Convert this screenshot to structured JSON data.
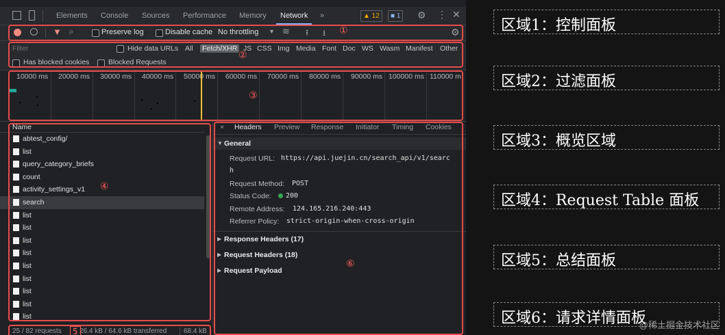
{
  "tabs": [
    "Elements",
    "Console",
    "Sources",
    "Performance",
    "Memory",
    "Network",
    "»"
  ],
  "active_tab": "Network",
  "badges": {
    "warnings": "▲ 12",
    "messages": "■ 1"
  },
  "toolbar": {
    "preserve_log": "Preserve log",
    "disable_cache": "Disable cache",
    "throttling": "No throttling"
  },
  "filter": {
    "placeholder": "Filter",
    "hide_data_urls": "Hide data URLs",
    "types": [
      "All",
      "Fetch/XHR",
      "JS",
      "CSS",
      "Img",
      "Media",
      "Font",
      "Doc",
      "WS",
      "Wasm",
      "Manifest",
      "Other"
    ],
    "selected_type": "Fetch/XHR",
    "has_blocked_cookies": "Has blocked cookies",
    "blocked_requests": "Blocked Requests"
  },
  "overview": {
    "ticks": [
      "10000 ms",
      "20000 ms",
      "30000 ms",
      "40000 ms",
      "50000 ms",
      "60000 ms",
      "70000 ms",
      "80000 ms",
      "90000 ms",
      "100000 ms",
      "110000 m"
    ]
  },
  "table": {
    "header": "Name",
    "rows": [
      "abtest_config/",
      "list",
      "query_category_briefs",
      "count",
      "activity_settings_v1",
      "search",
      "list",
      "list",
      "list",
      "list",
      "list",
      "list",
      "list",
      "list",
      "list"
    ],
    "selected_index": 5
  },
  "details": {
    "close": "×",
    "tabs": [
      "Headers",
      "Preview",
      "Response",
      "Initiator",
      "Timing",
      "Cookies"
    ],
    "active_tab": "Headers",
    "general_title": "General",
    "request_url_label": "Request URL:",
    "request_url_value": "https://api.juejin.cn/search_api/v1/searc",
    "request_url_wrap": "h",
    "method_label": "Request Method:",
    "method_value": "POST",
    "status_label": "Status Code:",
    "status_value": "200",
    "remote_label": "Remote Address:",
    "remote_value": "124.165.216.240:443",
    "referrer_label": "Referrer Policy:",
    "referrer_value": "strict-origin-when-cross-origin",
    "response_headers": "Response Headers (17)",
    "request_headers": "Request Headers (18)",
    "request_payload": "Request Payload"
  },
  "summary": {
    "requests": "25 / 82 requests",
    "transferred": "26.4 kB / 64.6 kB transferred",
    "resources": "68.4 kB"
  },
  "annotations": [
    "①",
    "②",
    "③",
    "④",
    "5",
    "⑥"
  ],
  "legend": [
    "区域1：控制面板",
    "区域2：过滤面板",
    "区域3：概览区域",
    "区域4：Request Table 面板",
    "区域5：总结面板",
    "区域6：请求详情面板"
  ],
  "watermark": "@稀土掘金技术社区",
  "colors": {
    "annotation_red": "#e74c4c",
    "accent_blue": "#8ab4f8",
    "status_green": "#34a853"
  }
}
